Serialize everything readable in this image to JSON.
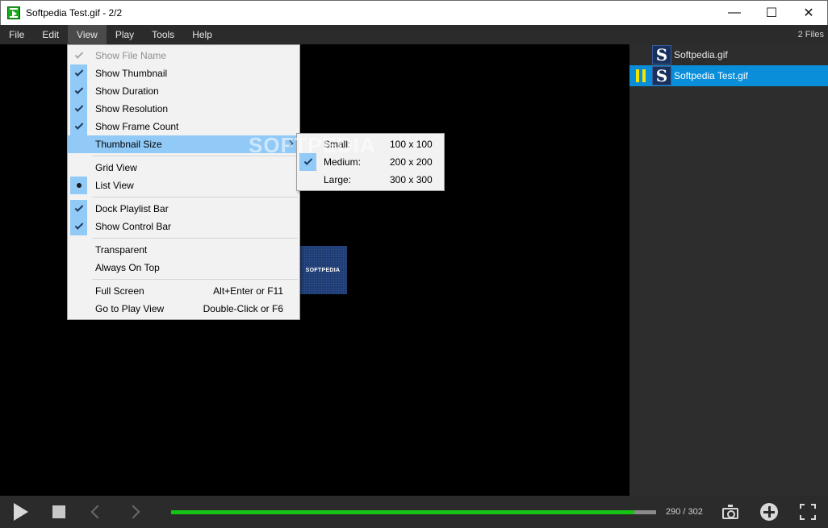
{
  "window": {
    "title": "Softpedia Test.gif - 2/2",
    "minimize": "—",
    "maximize": "☐",
    "close": "✕"
  },
  "menubar": {
    "items": [
      "File",
      "Edit",
      "View",
      "Play",
      "Tools",
      "Help"
    ],
    "active": "View",
    "files_count": "2 Files"
  },
  "view_menu": {
    "items": [
      {
        "label": "Show File Name",
        "state": "checked-disabled"
      },
      {
        "label": "Show Thumbnail",
        "state": "checked"
      },
      {
        "label": "Show Duration",
        "state": "checked"
      },
      {
        "label": "Show Resolution",
        "state": "checked"
      },
      {
        "label": "Show Frame Count",
        "state": "checked"
      },
      {
        "label": "Thumbnail Size",
        "state": "submenu-open"
      },
      {
        "label": "Grid View",
        "state": "none"
      },
      {
        "label": "List View",
        "state": "radio"
      },
      {
        "label": "Dock Playlist Bar",
        "state": "checked"
      },
      {
        "label": "Show Control Bar",
        "state": "checked"
      },
      {
        "label": "Transparent",
        "state": "none"
      },
      {
        "label": "Always On Top",
        "state": "none"
      },
      {
        "label": "Full Screen",
        "shortcut": "Alt+Enter or F11"
      },
      {
        "label": "Go to Play View",
        "shortcut": "Double-Click or F6"
      }
    ]
  },
  "thumbnail_size_menu": {
    "items": [
      {
        "label": "Small:",
        "size": "100 x 100",
        "checked": false
      },
      {
        "label": "Medium:",
        "size": "200 x 200",
        "checked": true
      },
      {
        "label": "Large:",
        "size": "300 x 300",
        "checked": false
      }
    ]
  },
  "playlist": {
    "items": [
      {
        "name": "Softpedia.gif",
        "thumb_letter": "S",
        "selected": false,
        "playing": false
      },
      {
        "name": "Softpedia Test.gif",
        "thumb_letter": "S",
        "selected": true,
        "playing": true
      }
    ]
  },
  "preview": {
    "text": "SOFTPEDIA"
  },
  "watermark": "SOFTPEDIA",
  "controls": {
    "frame_counter": "290 / 302",
    "progress": 0.955
  },
  "colors": {
    "accent": "#0a8ed9",
    "progress": "#15c315",
    "menu_highlight": "#91c9f7",
    "pause": "#f5e400"
  }
}
